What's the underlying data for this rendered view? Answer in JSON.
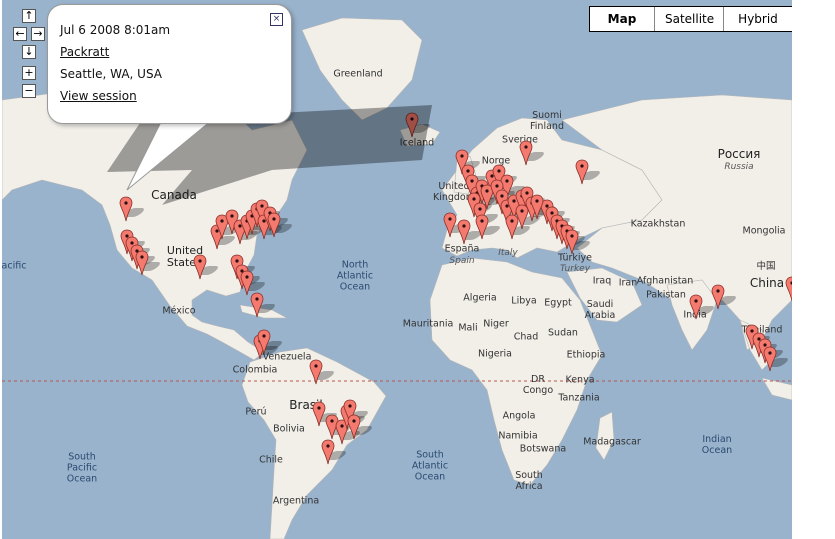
{
  "map_type": {
    "options": [
      "Map",
      "Satellite",
      "Hybrid"
    ],
    "selected": "Map"
  },
  "nav_controls": {
    "up": "↑",
    "left": "←",
    "right": "→",
    "down": "↓",
    "zoom_in": "+",
    "zoom_out": "−"
  },
  "info_window": {
    "date": "Jul 6 2008 8:01am",
    "user": "Packratt",
    "location": "Seattle, WA, USA",
    "link": "View session",
    "close": "×"
  },
  "labels": {
    "greenland": "Greenland",
    "iceland": "Iceland",
    "canada": "Canada",
    "united_states": "United\nStates",
    "mexico": "México",
    "pacific_left": "acific",
    "north_atlantic": "North\nAtlantic\nOcean",
    "sweden": "Sverige",
    "finland": "Suomi\nFinland",
    "norway": "Norge",
    "united_kingdom": "United\nKingdom",
    "russia_native": "Россия",
    "russia": "Russia",
    "kazakhstan": "Kazakhstan",
    "mongolia": "Mongolia",
    "china_native": "中国",
    "china": "China",
    "espana": "España",
    "spain": "Spain",
    "italy": "Italy",
    "turkiye": "Türkiye",
    "turkey": "Turkey",
    "afghanistan": "Afghanistan",
    "pakistan": "Pakistan",
    "india": "India",
    "thailand": "Thailand",
    "algeria": "Algeria",
    "libya": "Libya",
    "egypt": "Egypt",
    "saudi_arabia": "Saudi\nArabia",
    "iraq": "Iraq",
    "iran": "Iran",
    "mauritania": "Mauritania",
    "mali": "Mali",
    "niger": "Niger",
    "chad": "Chad",
    "sudan": "Sudan",
    "nigeria": "Nigeria",
    "ethiopia": "Ethiopia",
    "drc": "DR\nCongo",
    "kenya": "Kenya",
    "tanzania": "Tanzania",
    "angola": "Angola",
    "namibia": "Namibia",
    "botswana": "Botswana",
    "south_africa": "South\nAfrica",
    "madagascar": "Madagascar",
    "venezuela": "Venezuela",
    "colombia": "Colombia",
    "peru": "Perú",
    "brasil": "Brasil",
    "bolivia": "Bolivia",
    "chile": "Chile",
    "argentina": "Argentina",
    "south_pacific": "South\nPacific\nOcean",
    "south_atlantic": "South\nAtlantic\nOcean",
    "indian_ocean": "Indian\nOcean"
  },
  "colors": {
    "water": "#99b3cc",
    "land": "#f2efe9",
    "marker": "#f47a6f",
    "equator": "#b8574f"
  }
}
